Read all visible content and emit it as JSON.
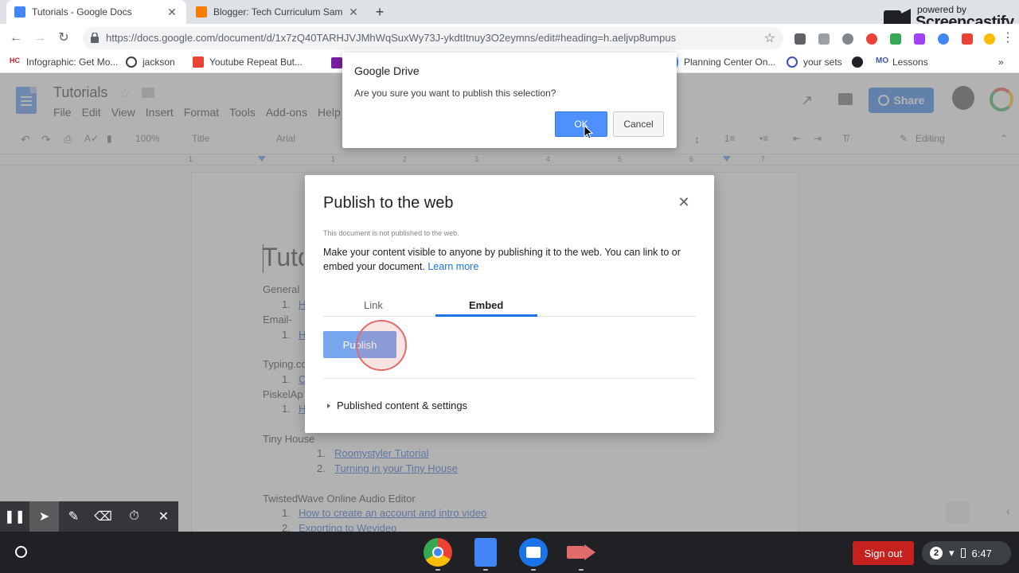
{
  "browser": {
    "tabs": [
      {
        "title": "Tutorials - Google Docs",
        "active": true,
        "favicon_color": "#4285f4"
      },
      {
        "title": "Blogger: Tech Curriculum Sampl",
        "active": false,
        "favicon_color": "#f57d00"
      }
    ],
    "url": "https://docs.google.com/document/d/1x7zQ40TARHJVJMhWqSuxWy73J-ykdtItnuy3O2eymns/edit#heading=h.aeljvp8umpus",
    "bookmarks": [
      "Infographic: Get Mo...",
      "jackson",
      "Youtube Repeat But...",
      "Planning Center On...",
      "your sets",
      "Lessons"
    ],
    "screencastify": {
      "powered_by": "powered by",
      "brand": "Screencastify"
    }
  },
  "docs": {
    "title": "Tutorials",
    "menu": [
      "File",
      "Edit",
      "View",
      "Insert",
      "Format",
      "Tools",
      "Add-ons",
      "Help"
    ],
    "share_label": "Share",
    "toolbar": {
      "zoom": "100%",
      "style": "Title",
      "font": "Arial",
      "mode": "Editing"
    },
    "ruler_numbers": [
      "1",
      "1",
      "2",
      "3",
      "4",
      "5",
      "6",
      "7"
    ],
    "doc_title_partial": "Tuto",
    "lines": [
      {
        "text": "General",
        "link": false
      },
      {
        "text": "1.",
        "link": false
      },
      {
        "text": "H",
        "link": true
      },
      {
        "text": "Email-",
        "link": false
      },
      {
        "text": "1.",
        "link": false
      },
      {
        "text": "H",
        "link": true
      },
      {
        "text": "Typing.co",
        "link": false
      },
      {
        "text": "1.",
        "link": false
      },
      {
        "text": "C",
        "link": true
      },
      {
        "text": "PiskelAp",
        "link": false
      },
      {
        "text": "1.",
        "link": false
      },
      {
        "text": "H",
        "link": true
      },
      {
        "text": "Tiny House",
        "link": false
      },
      {
        "text": "1.",
        "link": false
      },
      {
        "text": "Roomystyler Tutorial",
        "link": true
      },
      {
        "text": "2.",
        "link": false
      },
      {
        "text": "Turning in your Tiny House",
        "link": true
      },
      {
        "text": "TwistedWave Online Audio Editor",
        "link": false
      },
      {
        "text": "1.",
        "link": false
      },
      {
        "text": "How to create an account and intro video",
        "link": true
      },
      {
        "text": "2.",
        "link": false
      },
      {
        "text": "Exporting to Weyideo",
        "link": true
      }
    ]
  },
  "publish_dialog": {
    "title": "Publish to the web",
    "status": "This document is not published to the web.",
    "description": "Make your content visible to anyone by publishing it to the web. You can link to or embed your document.",
    "learn_more": "Learn more",
    "tabs": [
      "Link",
      "Embed"
    ],
    "selected_tab": "Embed",
    "publish_label": "Publish",
    "settings_label": "Published content & settings"
  },
  "confirm_dialog": {
    "title": "Google Drive",
    "message": "Are you sure you want to publish this selection?",
    "ok_label": "OK",
    "cancel_label": "Cancel"
  },
  "shelf": {
    "sign_out": "Sign out",
    "notifications": "2",
    "time": "6:47"
  }
}
